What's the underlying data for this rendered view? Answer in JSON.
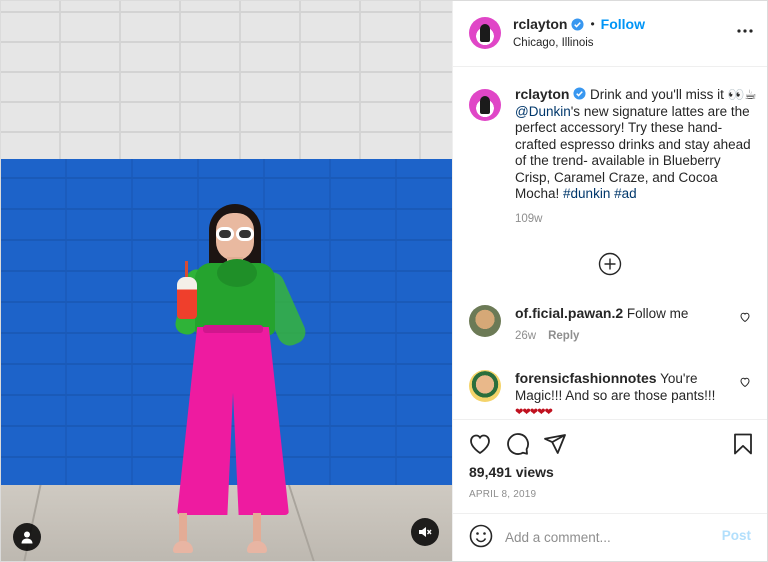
{
  "post": {
    "username": "rclayton",
    "follow_label": "Follow",
    "separator": "•",
    "location": "Chicago, Illinois"
  },
  "caption": {
    "username": "rclayton",
    "text_before_link": " Drink and you'll miss it 👀☕ ",
    "mention": "@Dunkin",
    "text_after_link": "'s new signature lattes are the perfect accessory! Try these hand-crafted espresso drinks and stay ahead of the trend- available in Blueberry Crisp, Caramel Craze, and Cocoa Mocha! ",
    "hashtag1": "#dunkin",
    "hashtag2": "#ad",
    "time": "109w"
  },
  "comments": [
    {
      "username": "of.ficial.pawan.2",
      "text": "Follow me",
      "time": "26w",
      "reply_label": "Reply"
    },
    {
      "username": "forensicfashionnotes",
      "text": "You're Magic!!! And so are those pants!!!",
      "hearts": "❤❤❤❤❤"
    }
  ],
  "stats": {
    "views": "89,491 views",
    "date": "APRIL 8, 2019"
  },
  "add_comment": {
    "placeholder": "Add a comment...",
    "post_label": "Post"
  },
  "colors": {
    "accent": "#0095f6",
    "link": "#00376b",
    "post_disabled": "#b2dffc",
    "wall_blue": "#1d63c9",
    "pants_pink": "#ee1ba0",
    "blouse_green": "#25a32e"
  },
  "icons": {
    "verified": "verified-badge-icon",
    "more": "more-options-icon",
    "load_more": "plus-circle-icon",
    "like": "heart-icon",
    "comment": "comment-icon",
    "share": "paper-plane-icon",
    "save": "bookmark-icon",
    "emoji": "smiley-icon",
    "tagged_user": "user-icon",
    "mute": "mute-icon"
  }
}
